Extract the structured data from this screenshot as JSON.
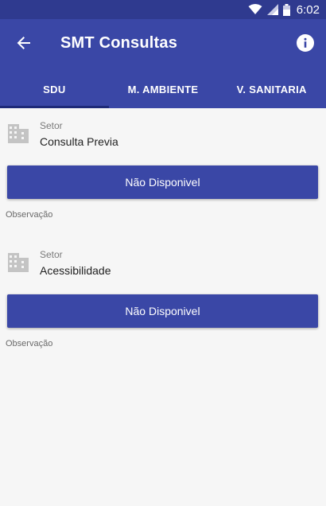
{
  "status_bar": {
    "time": "6:02",
    "icons": [
      "wifi-icon",
      "signal-icon",
      "battery-icon"
    ]
  },
  "app_bar": {
    "title": "SMT Consultas",
    "back_icon": "arrow-back-icon",
    "info_icon": "info-icon"
  },
  "tabs": [
    {
      "label": "SDU",
      "active": true
    },
    {
      "label": "M. AMBIENTE",
      "active": false
    },
    {
      "label": "V. SANITARIA",
      "active": false
    }
  ],
  "cards": [
    {
      "icon": "building-icon",
      "sector_label": "Setor",
      "sector_value": "Consulta Previa",
      "button_label": "Não Disponivel",
      "observation_label": "Observação"
    },
    {
      "icon": "building-icon",
      "sector_label": "Setor",
      "sector_value": "Acessibilidade",
      "button_label": "Não Disponivel",
      "observation_label": "Observação"
    }
  ],
  "colors": {
    "primary": "#3a47a6",
    "status_bar": "#2f3a8f",
    "background": "#f6f6f6"
  }
}
